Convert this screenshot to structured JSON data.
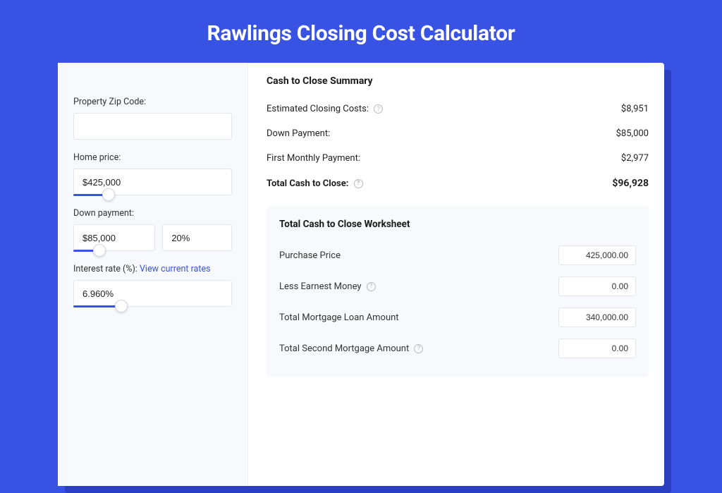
{
  "title": "Rawlings Closing Cost Calculator",
  "left": {
    "zip_label": "Property Zip Code:",
    "zip_value": "",
    "home_price_label": "Home price:",
    "home_price_value": "$425,000",
    "home_price_slider_pct": 22,
    "down_payment_label": "Down payment:",
    "down_payment_value": "$85,000",
    "down_payment_pct_value": "20%",
    "down_payment_slider_pct": 32,
    "interest_label": "Interest rate (%):",
    "interest_link": "View current rates",
    "interest_value": "6.960%",
    "interest_slider_pct": 30
  },
  "summary": {
    "heading": "Cash to Close Summary",
    "rows": [
      {
        "label": "Estimated Closing Costs:",
        "value": "$8,951",
        "help": true
      },
      {
        "label": "Down Payment:",
        "value": "$85,000",
        "help": false
      },
      {
        "label": "First Monthly Payment:",
        "value": "$2,977",
        "help": false
      }
    ],
    "total_label": "Total Cash to Close:",
    "total_value": "$96,928"
  },
  "worksheet": {
    "heading": "Total Cash to Close Worksheet",
    "rows": [
      {
        "label": "Purchase Price",
        "value": "425,000.00",
        "help": false
      },
      {
        "label": "Less Earnest Money",
        "value": "0.00",
        "help": true
      },
      {
        "label": "Total Mortgage Loan Amount",
        "value": "340,000.00",
        "help": false
      },
      {
        "label": "Total Second Mortgage Amount",
        "value": "0.00",
        "help": true
      }
    ]
  }
}
